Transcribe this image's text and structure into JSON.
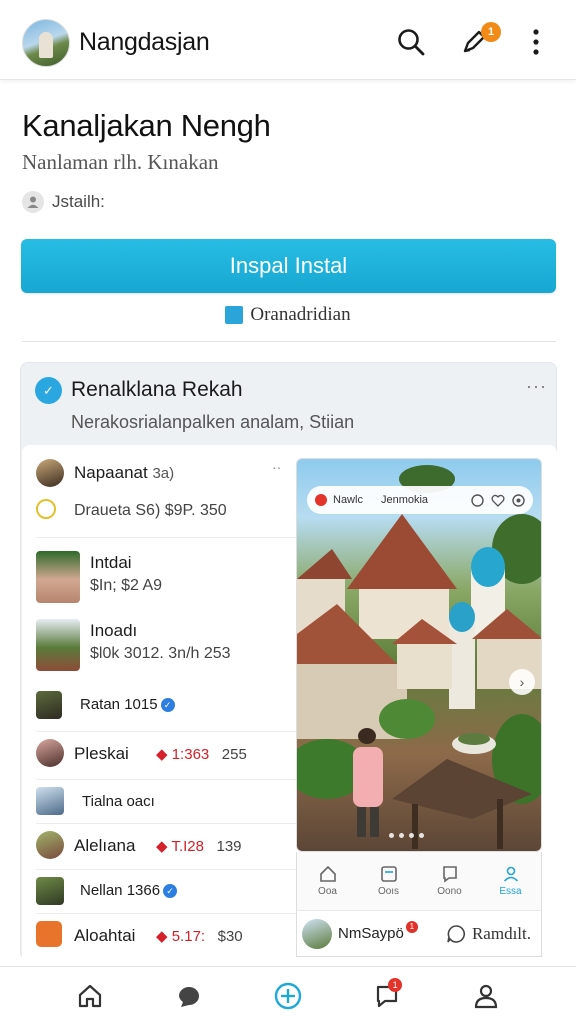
{
  "app": {
    "title": "Nangdasjan",
    "notification_count": "1"
  },
  "header": {
    "title": "Kanaljakan Nengh",
    "subtitle": "Nanlaman rlh. Kınakan",
    "author": "Jstailh:",
    "install_label": "Inspal Instal",
    "learn_label": "Oranadridian"
  },
  "card": {
    "title": "Renalklana Rekah",
    "description": "Nerakosrialanpalken analam, Stiian",
    "more": "···"
  },
  "list": [
    {
      "name": "Napaanat",
      "extra": "3a)",
      "meta": "Draueta  S6)  $9P.  350",
      "more": "··"
    },
    {
      "name": "Intdai",
      "meta": "$In;  $2   A9"
    },
    {
      "name": "Inoadı",
      "meta": "$l0k  3012. 3n/h   253"
    },
    {
      "name": "Ratan 1015",
      "verified": true
    },
    {
      "name": "Pleskai",
      "value": "1:363",
      "count": "255"
    },
    {
      "name": "Tialna oacı"
    },
    {
      "name": "Alelıana",
      "value": "T.I28",
      "count": "139"
    },
    {
      "name": "Nellan 1366",
      "verified": true
    },
    {
      "name": "Aloahtai",
      "value": "5.17:",
      "count": "$30"
    }
  ],
  "preview": {
    "bar_left": "Nawlc",
    "bar_right": "Jenmokia",
    "nav": [
      {
        "label": "Ooa",
        "icon": "home-icon"
      },
      {
        "label": "Ooıs",
        "icon": "list-icon"
      },
      {
        "label": "Oono",
        "icon": "message-icon"
      },
      {
        "label": "Essa",
        "icon": "profile-icon",
        "active": true
      }
    ],
    "footer_name": "NmSaypö",
    "footer_badge": "1",
    "footer_button": "Ramdılt."
  },
  "bottom_nav": {
    "badge": "1",
    "items": [
      "home-icon",
      "chat-bubble-icon",
      "add-circle-icon",
      "comment-icon",
      "profile-icon"
    ]
  },
  "colors": {
    "accent": "#1ca9d6",
    "badge_orange": "#f18a17",
    "badge_red": "#e3332b",
    "value_red": "#d6202a"
  }
}
